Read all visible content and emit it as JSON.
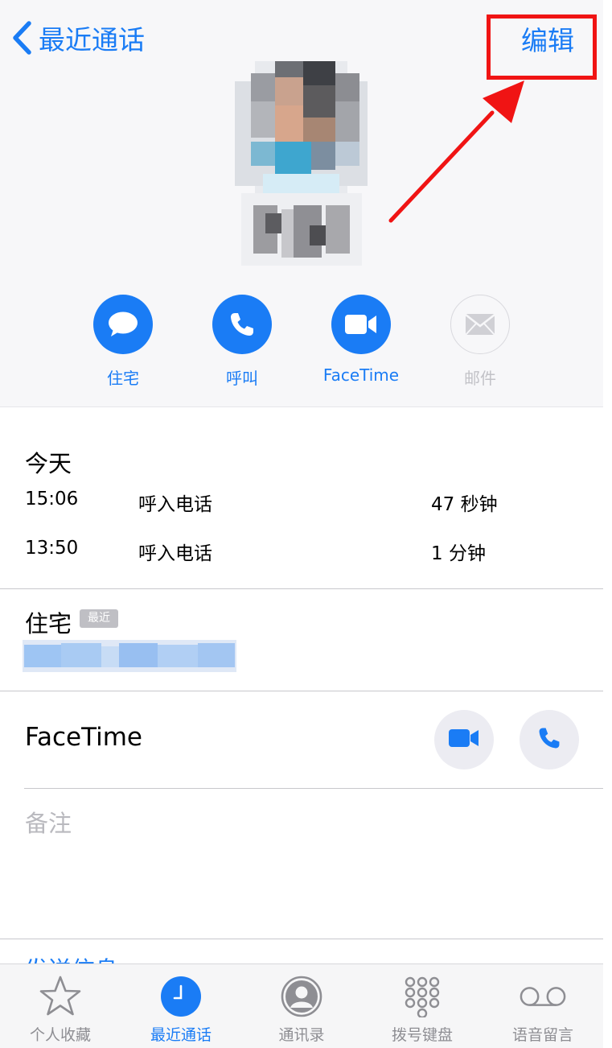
{
  "nav": {
    "back_label": "最近通话",
    "edit_label": "编辑"
  },
  "actions": [
    {
      "label": "住宅",
      "icon": "message-icon",
      "enabled": true
    },
    {
      "label": "呼叫",
      "icon": "phone-icon",
      "enabled": true
    },
    {
      "label": "FaceTime",
      "icon": "video-icon",
      "enabled": true
    },
    {
      "label": "邮件",
      "icon": "mail-icon",
      "enabled": false
    }
  ],
  "recents": {
    "title": "今天",
    "calls": [
      {
        "time": "15:06",
        "type": "呼入电话",
        "duration": "47 秒钟"
      },
      {
        "time": "13:50",
        "type": "呼入电话",
        "duration": "1 分钟"
      }
    ]
  },
  "phone": {
    "label": "住宅",
    "badge": "最近"
  },
  "facetime": {
    "label": "FaceTime"
  },
  "notes": {
    "label": "备注"
  },
  "send_message": {
    "label": "发送信息"
  },
  "tabs": [
    {
      "label": "个人收藏",
      "icon": "star-icon",
      "active": false
    },
    {
      "label": "最近通话",
      "icon": "clock-icon",
      "active": true
    },
    {
      "label": "通讯录",
      "icon": "contacts-icon",
      "active": false
    },
    {
      "label": "拨号键盘",
      "icon": "keypad-icon",
      "active": false
    },
    {
      "label": "语音留言",
      "icon": "voicemail-icon",
      "active": false
    }
  ],
  "colors": {
    "accent": "#1a7cf5",
    "annotation": "#f01414",
    "header_bg": "#f7f7f9",
    "tab_inactive": "#8e8e93"
  }
}
